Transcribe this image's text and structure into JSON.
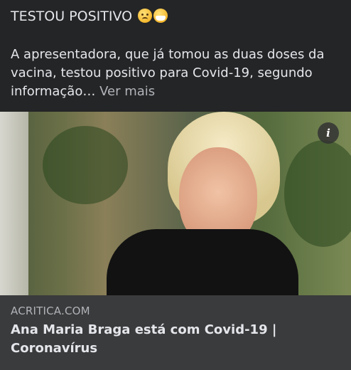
{
  "post": {
    "headline": "TESTOU POSITIVO",
    "headline_emojis": [
      "sad-sweat-emoji",
      "medical-mask-emoji"
    ],
    "body_text": "A apresentadora, que já tomou as duas doses da vacina, testou positivo para Covid-19, segundo informação…",
    "see_more": "Ver mais"
  },
  "link_preview": {
    "info_icon": "i",
    "domain": "ACRITICA.COM",
    "title": "Ana Maria Braga está com Covid-19 | Coronavírus"
  },
  "colors": {
    "background": "#242526",
    "text": "#e4e6eb",
    "muted": "#b0b3b8",
    "footer": "#3a3b3c"
  }
}
